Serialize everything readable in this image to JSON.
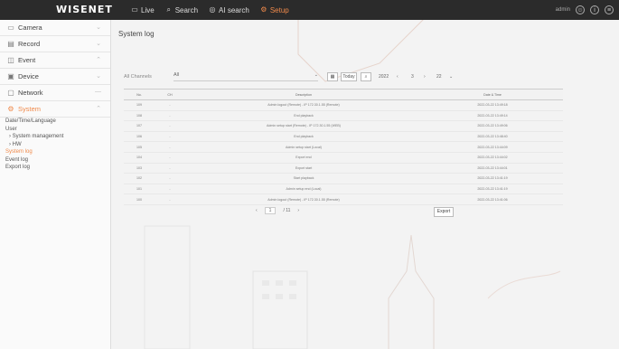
{
  "app": {
    "logo": "WISENET"
  },
  "topmenu": [
    {
      "label": "Live",
      "icon": "monitor-icon"
    },
    {
      "label": "Search",
      "icon": "search-icon"
    },
    {
      "label": "AI search",
      "icon": "ai-search-icon"
    },
    {
      "label": "Setup",
      "icon": "gear-icon",
      "active": true
    }
  ],
  "topright": {
    "user": "admin"
  },
  "sidebar": {
    "items": [
      {
        "label": "Camera",
        "icon": "camera-icon"
      },
      {
        "label": "Record",
        "icon": "record-icon"
      },
      {
        "label": "Event",
        "icon": "event-icon"
      },
      {
        "label": "Device",
        "icon": "device-icon"
      },
      {
        "label": "Network",
        "icon": "network-icon"
      },
      {
        "label": "System",
        "icon": "system-icon",
        "active": true
      }
    ],
    "subitems": [
      {
        "label": "Date/Time/Language"
      },
      {
        "label": "User"
      },
      {
        "label": "› System management"
      },
      {
        "label": "› HW"
      },
      {
        "label": "System log",
        "active": true
      },
      {
        "label": "Event log"
      },
      {
        "label": "Export log"
      }
    ]
  },
  "main": {
    "title": "System log",
    "filter": {
      "label": "All Channels",
      "value": "All"
    },
    "buttons": {
      "today": "Today"
    },
    "date": {
      "year": "2022",
      "month": "3",
      "day": "22"
    },
    "table": {
      "headers": [
        "No.",
        "CH",
        "Description",
        "Date & Time"
      ],
      "rows": [
        [
          "109",
          "-",
          "Admin logout (Remote) - IP 172.30.1.55 (Remote)",
          "2022-03-22 13:49:18"
        ],
        [
          "108",
          "-",
          "End playback",
          "2022-03-22 13:49:14"
        ],
        [
          "107",
          "-",
          "Admin setup start (Remote) - IP 172.30.1.55 (WEB)",
          "2022-03-22 13:49:06"
        ],
        [
          "106",
          "-",
          "End playback",
          "2022-03-22 13:48:40"
        ],
        [
          "105",
          "-",
          "Admin setup start (Local)",
          "2022-03-22 13:44:09"
        ],
        [
          "104",
          "-",
          "Export end",
          "2022-03-22 13:44:02"
        ],
        [
          "103",
          "-",
          "Export start",
          "2022-03-22 13:44:01"
        ],
        [
          "102",
          "-",
          "Start playback",
          "2022-03-22 13:41:19"
        ],
        [
          "101",
          "-",
          "Admin setup end (Local)",
          "2022-03-22 13:41:19"
        ],
        [
          "100",
          "-",
          "Admin logout (Remote) - IP 172.30.1.55 (Remote)",
          "2022-03-22 13:41:06"
        ]
      ]
    },
    "pager": {
      "prev": "‹",
      "current": "1",
      "total": "/ 11",
      "next": "›"
    },
    "export": "Export"
  }
}
